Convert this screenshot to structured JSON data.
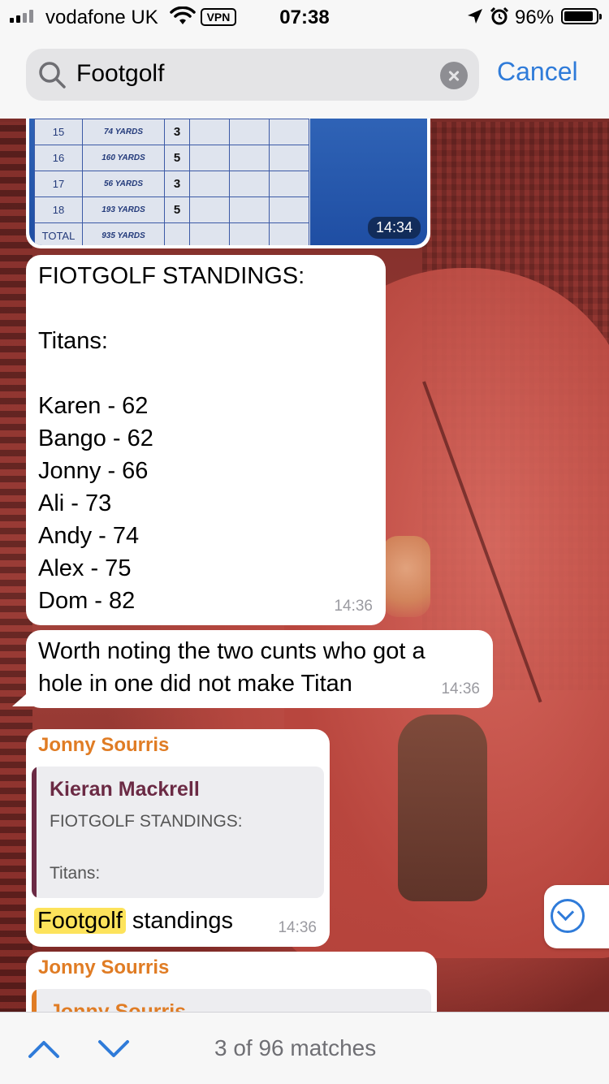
{
  "status_bar": {
    "carrier": "vodafone UK",
    "vpn": "VPN",
    "time": "07:38",
    "battery": "96%"
  },
  "search": {
    "query": "Footgolf",
    "cancel_label": "Cancel"
  },
  "photo_message": {
    "scorecard_rows": [
      {
        "hole": "15",
        "yards": "74 YARDS",
        "par": "3"
      },
      {
        "hole": "16",
        "yards": "160 YARDS",
        "par": "5"
      },
      {
        "hole": "17",
        "yards": "56 YARDS",
        "par": "3"
      },
      {
        "hole": "18",
        "yards": "193 YARDS",
        "par": "5"
      },
      {
        "hole": "TOTAL",
        "yards": "935 YARDS",
        "par": ""
      }
    ],
    "time": "14:34"
  },
  "messages": [
    {
      "text": "FIOTGOLF STANDINGS:\n\nTitans:\n\nKaren - 62\nBango - 62\nJonny - 66\nAli - 73\nAndy - 74\nAlex - 75\nDom - 82",
      "time": "14:36"
    },
    {
      "text": "Worth noting the two cunts who got a\nhole in one did not make Titan",
      "time": "14:36"
    },
    {
      "sender": "Jonny Sourris",
      "reply": {
        "name": "Kieran Mackrell",
        "text": "FIOTGOLF STANDINGS:\n\nTitans:"
      },
      "highlight": "Footgolf",
      "rest": " standings",
      "time": "14:36"
    },
    {
      "sender": "Jonny Sourris",
      "reply": {
        "name": "Jonny Sourris"
      }
    }
  ],
  "bottom_bar": {
    "matches": "3 of 96 matches"
  },
  "colors": {
    "accent": "#2f7bd9",
    "sender": "#e07c24",
    "reply_author": "#6b2a44",
    "highlight": "#fde35b"
  }
}
